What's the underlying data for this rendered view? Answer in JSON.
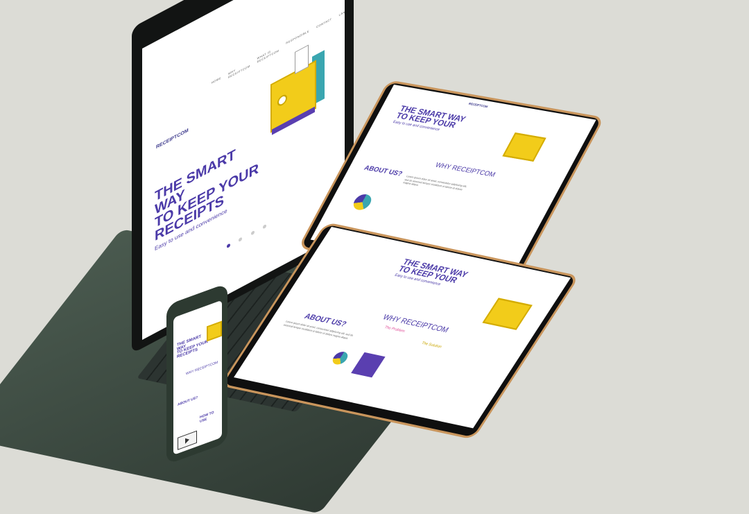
{
  "brand": "RECEIPTCOM",
  "nav": [
    "HOME",
    "WHY RECEIPTCOM",
    "WHAT IS RECEIPTCOM",
    "RESPONSIBLE",
    "CONTACT",
    "LANGUAGE"
  ],
  "hero": {
    "title_line1": "THE SMART WAY",
    "title_line2": "TO KEEP YOUR",
    "title_line3": "RECEIPTS",
    "subtitle": "Easy to use and convenience"
  },
  "sections": {
    "why": "WHY RECEIPTCOM",
    "about": "ABOUT US?",
    "how": "HOW TO USE",
    "problem": "The Problem",
    "solution": "The Solution",
    "lorem": "Lorem ipsum dolor sit amet, consectetur adipiscing elit, sed do eiusmod tempor incididunt ut labore et dolore magna aliqua."
  },
  "colors": {
    "background": "#dcdcd6",
    "brand_purple": "#4b3aa8",
    "safe_yellow": "#f2cc1a",
    "teal": "#3aa6b0",
    "tablet_frame": "#c9955c",
    "laptop_body": "#2f3a33"
  },
  "icons": [
    "safe-icon",
    "receipt-icon",
    "pie-chart-icon",
    "cards-icon",
    "play-icon"
  ]
}
